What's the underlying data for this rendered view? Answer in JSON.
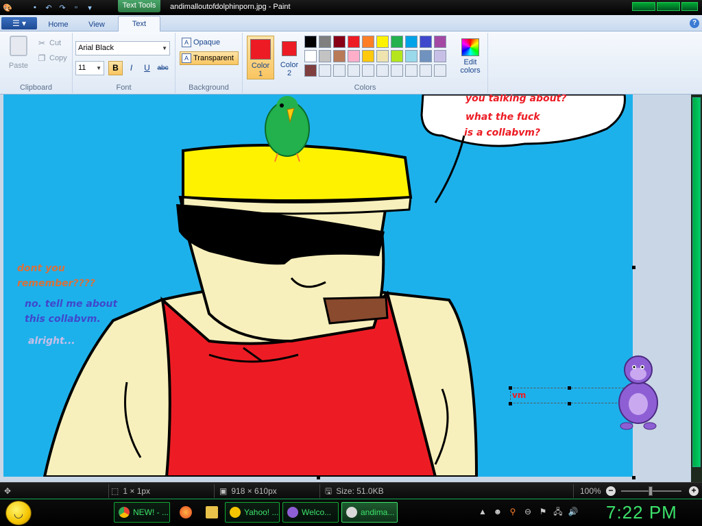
{
  "titlebar": {
    "contextual_tab": "Text Tools",
    "title": "andimalloutofdolphinporn.jpg - Paint"
  },
  "ribbon_tabs": {
    "home": "Home",
    "view": "View",
    "text": "Text",
    "help_icon": "?"
  },
  "clipboard": {
    "paste": "Paste",
    "cut": "Cut",
    "copy": "Copy",
    "group_label": "Clipboard"
  },
  "font": {
    "family": "Arial Black",
    "size": "11",
    "bold": "B",
    "italic": "I",
    "underline": "U",
    "strikethrough": "abc",
    "group_label": "Font"
  },
  "background": {
    "opaque": "Opaque",
    "transparent": "Transparent",
    "group_label": "Background",
    "selected": "Transparent"
  },
  "colors": {
    "color1_label": "Color\n1",
    "color1_line1": "Color",
    "color1_line2": "1",
    "color2_line1": "Color",
    "color2_line2": "2",
    "color1": "#ed1c24",
    "color2": "#ed1c24",
    "edit_line1": "Edit",
    "edit_line2": "colors",
    "group_label": "Colors",
    "palette": [
      "#000000",
      "#7f7f7f",
      "#880015",
      "#ed1c24",
      "#ff7f27",
      "#fff200",
      "#22b14c",
      "#00a2e8",
      "#3f48cc",
      "#a349a4",
      "#ffffff",
      "#c3c3c3",
      "#b97a57",
      "#ffaec9",
      "#ffc90e",
      "#efe4b0",
      "#b5e61d",
      "#99d9ea",
      "#7092be",
      "#c8bfe7",
      "#7f3f3f",
      "#e4ebf4",
      "#e4ebf4",
      "#e4ebf4",
      "#e4ebf4",
      "#e4ebf4",
      "#e4ebf4",
      "#e4ebf4",
      "#e4ebf4",
      "#e4ebf4"
    ]
  },
  "canvas_text": {
    "bubble_line1": "you talking about?",
    "bubble_line2": "what the fuck",
    "bubble_line3": "is a collabvm?",
    "left_line1": "dont you",
    "left_line2": "remember????",
    "left_line3": "no. tell me about",
    "left_line4": "this collabvm.",
    "left_line5": "alright...",
    "text_box_value": "vm"
  },
  "statusbar": {
    "cursor_pos": "1 × 1px",
    "selection_size": "918 × 610px",
    "file_size": "Size: 51.0KB",
    "zoom": "100%",
    "zoom_out": "−",
    "zoom_in": "+"
  },
  "taskbar": {
    "tasks": [
      {
        "label": "NEW! - ...",
        "icon": "chrome-icon"
      },
      {
        "label": "Yahoo! ...",
        "icon": "yahoo-icon"
      },
      {
        "label": "Welco...",
        "icon": "bonzi-icon"
      },
      {
        "label": "andima...",
        "icon": "paint-icon"
      }
    ],
    "clock": "7:22 PM"
  }
}
